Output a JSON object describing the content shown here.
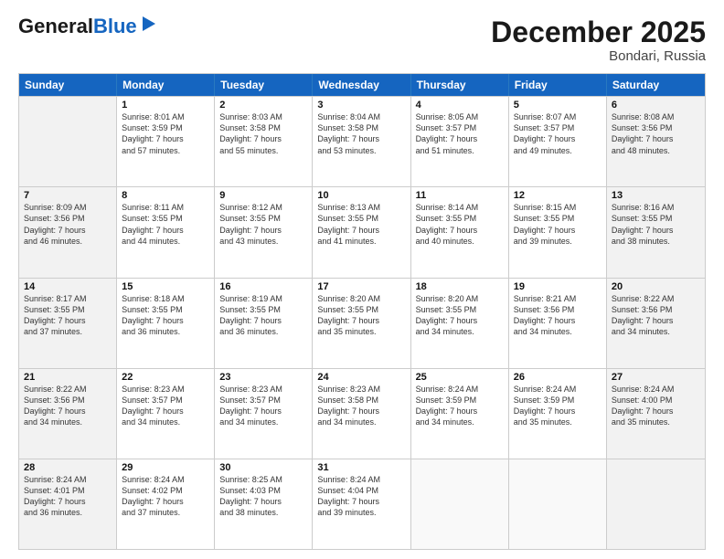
{
  "header": {
    "logo_line1": "General",
    "logo_line2": "Blue",
    "month_year": "December 2025",
    "location": "Bondari, Russia"
  },
  "days_of_week": [
    "Sunday",
    "Monday",
    "Tuesday",
    "Wednesday",
    "Thursday",
    "Friday",
    "Saturday"
  ],
  "rows": [
    [
      {
        "day": "",
        "info": "",
        "shaded": true
      },
      {
        "day": "1",
        "info": "Sunrise: 8:01 AM\nSunset: 3:59 PM\nDaylight: 7 hours\nand 57 minutes.",
        "shaded": false
      },
      {
        "day": "2",
        "info": "Sunrise: 8:03 AM\nSunset: 3:58 PM\nDaylight: 7 hours\nand 55 minutes.",
        "shaded": false
      },
      {
        "day": "3",
        "info": "Sunrise: 8:04 AM\nSunset: 3:58 PM\nDaylight: 7 hours\nand 53 minutes.",
        "shaded": false
      },
      {
        "day": "4",
        "info": "Sunrise: 8:05 AM\nSunset: 3:57 PM\nDaylight: 7 hours\nand 51 minutes.",
        "shaded": false
      },
      {
        "day": "5",
        "info": "Sunrise: 8:07 AM\nSunset: 3:57 PM\nDaylight: 7 hours\nand 49 minutes.",
        "shaded": false
      },
      {
        "day": "6",
        "info": "Sunrise: 8:08 AM\nSunset: 3:56 PM\nDaylight: 7 hours\nand 48 minutes.",
        "shaded": true
      }
    ],
    [
      {
        "day": "7",
        "info": "Sunrise: 8:09 AM\nSunset: 3:56 PM\nDaylight: 7 hours\nand 46 minutes.",
        "shaded": true
      },
      {
        "day": "8",
        "info": "Sunrise: 8:11 AM\nSunset: 3:55 PM\nDaylight: 7 hours\nand 44 minutes.",
        "shaded": false
      },
      {
        "day": "9",
        "info": "Sunrise: 8:12 AM\nSunset: 3:55 PM\nDaylight: 7 hours\nand 43 minutes.",
        "shaded": false
      },
      {
        "day": "10",
        "info": "Sunrise: 8:13 AM\nSunset: 3:55 PM\nDaylight: 7 hours\nand 41 minutes.",
        "shaded": false
      },
      {
        "day": "11",
        "info": "Sunrise: 8:14 AM\nSunset: 3:55 PM\nDaylight: 7 hours\nand 40 minutes.",
        "shaded": false
      },
      {
        "day": "12",
        "info": "Sunrise: 8:15 AM\nSunset: 3:55 PM\nDaylight: 7 hours\nand 39 minutes.",
        "shaded": false
      },
      {
        "day": "13",
        "info": "Sunrise: 8:16 AM\nSunset: 3:55 PM\nDaylight: 7 hours\nand 38 minutes.",
        "shaded": true
      }
    ],
    [
      {
        "day": "14",
        "info": "Sunrise: 8:17 AM\nSunset: 3:55 PM\nDaylight: 7 hours\nand 37 minutes.",
        "shaded": true
      },
      {
        "day": "15",
        "info": "Sunrise: 8:18 AM\nSunset: 3:55 PM\nDaylight: 7 hours\nand 36 minutes.",
        "shaded": false
      },
      {
        "day": "16",
        "info": "Sunrise: 8:19 AM\nSunset: 3:55 PM\nDaylight: 7 hours\nand 36 minutes.",
        "shaded": false
      },
      {
        "day": "17",
        "info": "Sunrise: 8:20 AM\nSunset: 3:55 PM\nDaylight: 7 hours\nand 35 minutes.",
        "shaded": false
      },
      {
        "day": "18",
        "info": "Sunrise: 8:20 AM\nSunset: 3:55 PM\nDaylight: 7 hours\nand 34 minutes.",
        "shaded": false
      },
      {
        "day": "19",
        "info": "Sunrise: 8:21 AM\nSunset: 3:56 PM\nDaylight: 7 hours\nand 34 minutes.",
        "shaded": false
      },
      {
        "day": "20",
        "info": "Sunrise: 8:22 AM\nSunset: 3:56 PM\nDaylight: 7 hours\nand 34 minutes.",
        "shaded": true
      }
    ],
    [
      {
        "day": "21",
        "info": "Sunrise: 8:22 AM\nSunset: 3:56 PM\nDaylight: 7 hours\nand 34 minutes.",
        "shaded": true
      },
      {
        "day": "22",
        "info": "Sunrise: 8:23 AM\nSunset: 3:57 PM\nDaylight: 7 hours\nand 34 minutes.",
        "shaded": false
      },
      {
        "day": "23",
        "info": "Sunrise: 8:23 AM\nSunset: 3:57 PM\nDaylight: 7 hours\nand 34 minutes.",
        "shaded": false
      },
      {
        "day": "24",
        "info": "Sunrise: 8:23 AM\nSunset: 3:58 PM\nDaylight: 7 hours\nand 34 minutes.",
        "shaded": false
      },
      {
        "day": "25",
        "info": "Sunrise: 8:24 AM\nSunset: 3:59 PM\nDaylight: 7 hours\nand 34 minutes.",
        "shaded": false
      },
      {
        "day": "26",
        "info": "Sunrise: 8:24 AM\nSunset: 3:59 PM\nDaylight: 7 hours\nand 35 minutes.",
        "shaded": false
      },
      {
        "day": "27",
        "info": "Sunrise: 8:24 AM\nSunset: 4:00 PM\nDaylight: 7 hours\nand 35 minutes.",
        "shaded": true
      }
    ],
    [
      {
        "day": "28",
        "info": "Sunrise: 8:24 AM\nSunset: 4:01 PM\nDaylight: 7 hours\nand 36 minutes.",
        "shaded": true
      },
      {
        "day": "29",
        "info": "Sunrise: 8:24 AM\nSunset: 4:02 PM\nDaylight: 7 hours\nand 37 minutes.",
        "shaded": false
      },
      {
        "day": "30",
        "info": "Sunrise: 8:25 AM\nSunset: 4:03 PM\nDaylight: 7 hours\nand 38 minutes.",
        "shaded": false
      },
      {
        "day": "31",
        "info": "Sunrise: 8:24 AM\nSunset: 4:04 PM\nDaylight: 7 hours\nand 39 minutes.",
        "shaded": false
      },
      {
        "day": "",
        "info": "",
        "shaded": false
      },
      {
        "day": "",
        "info": "",
        "shaded": false
      },
      {
        "day": "",
        "info": "",
        "shaded": true
      }
    ]
  ]
}
